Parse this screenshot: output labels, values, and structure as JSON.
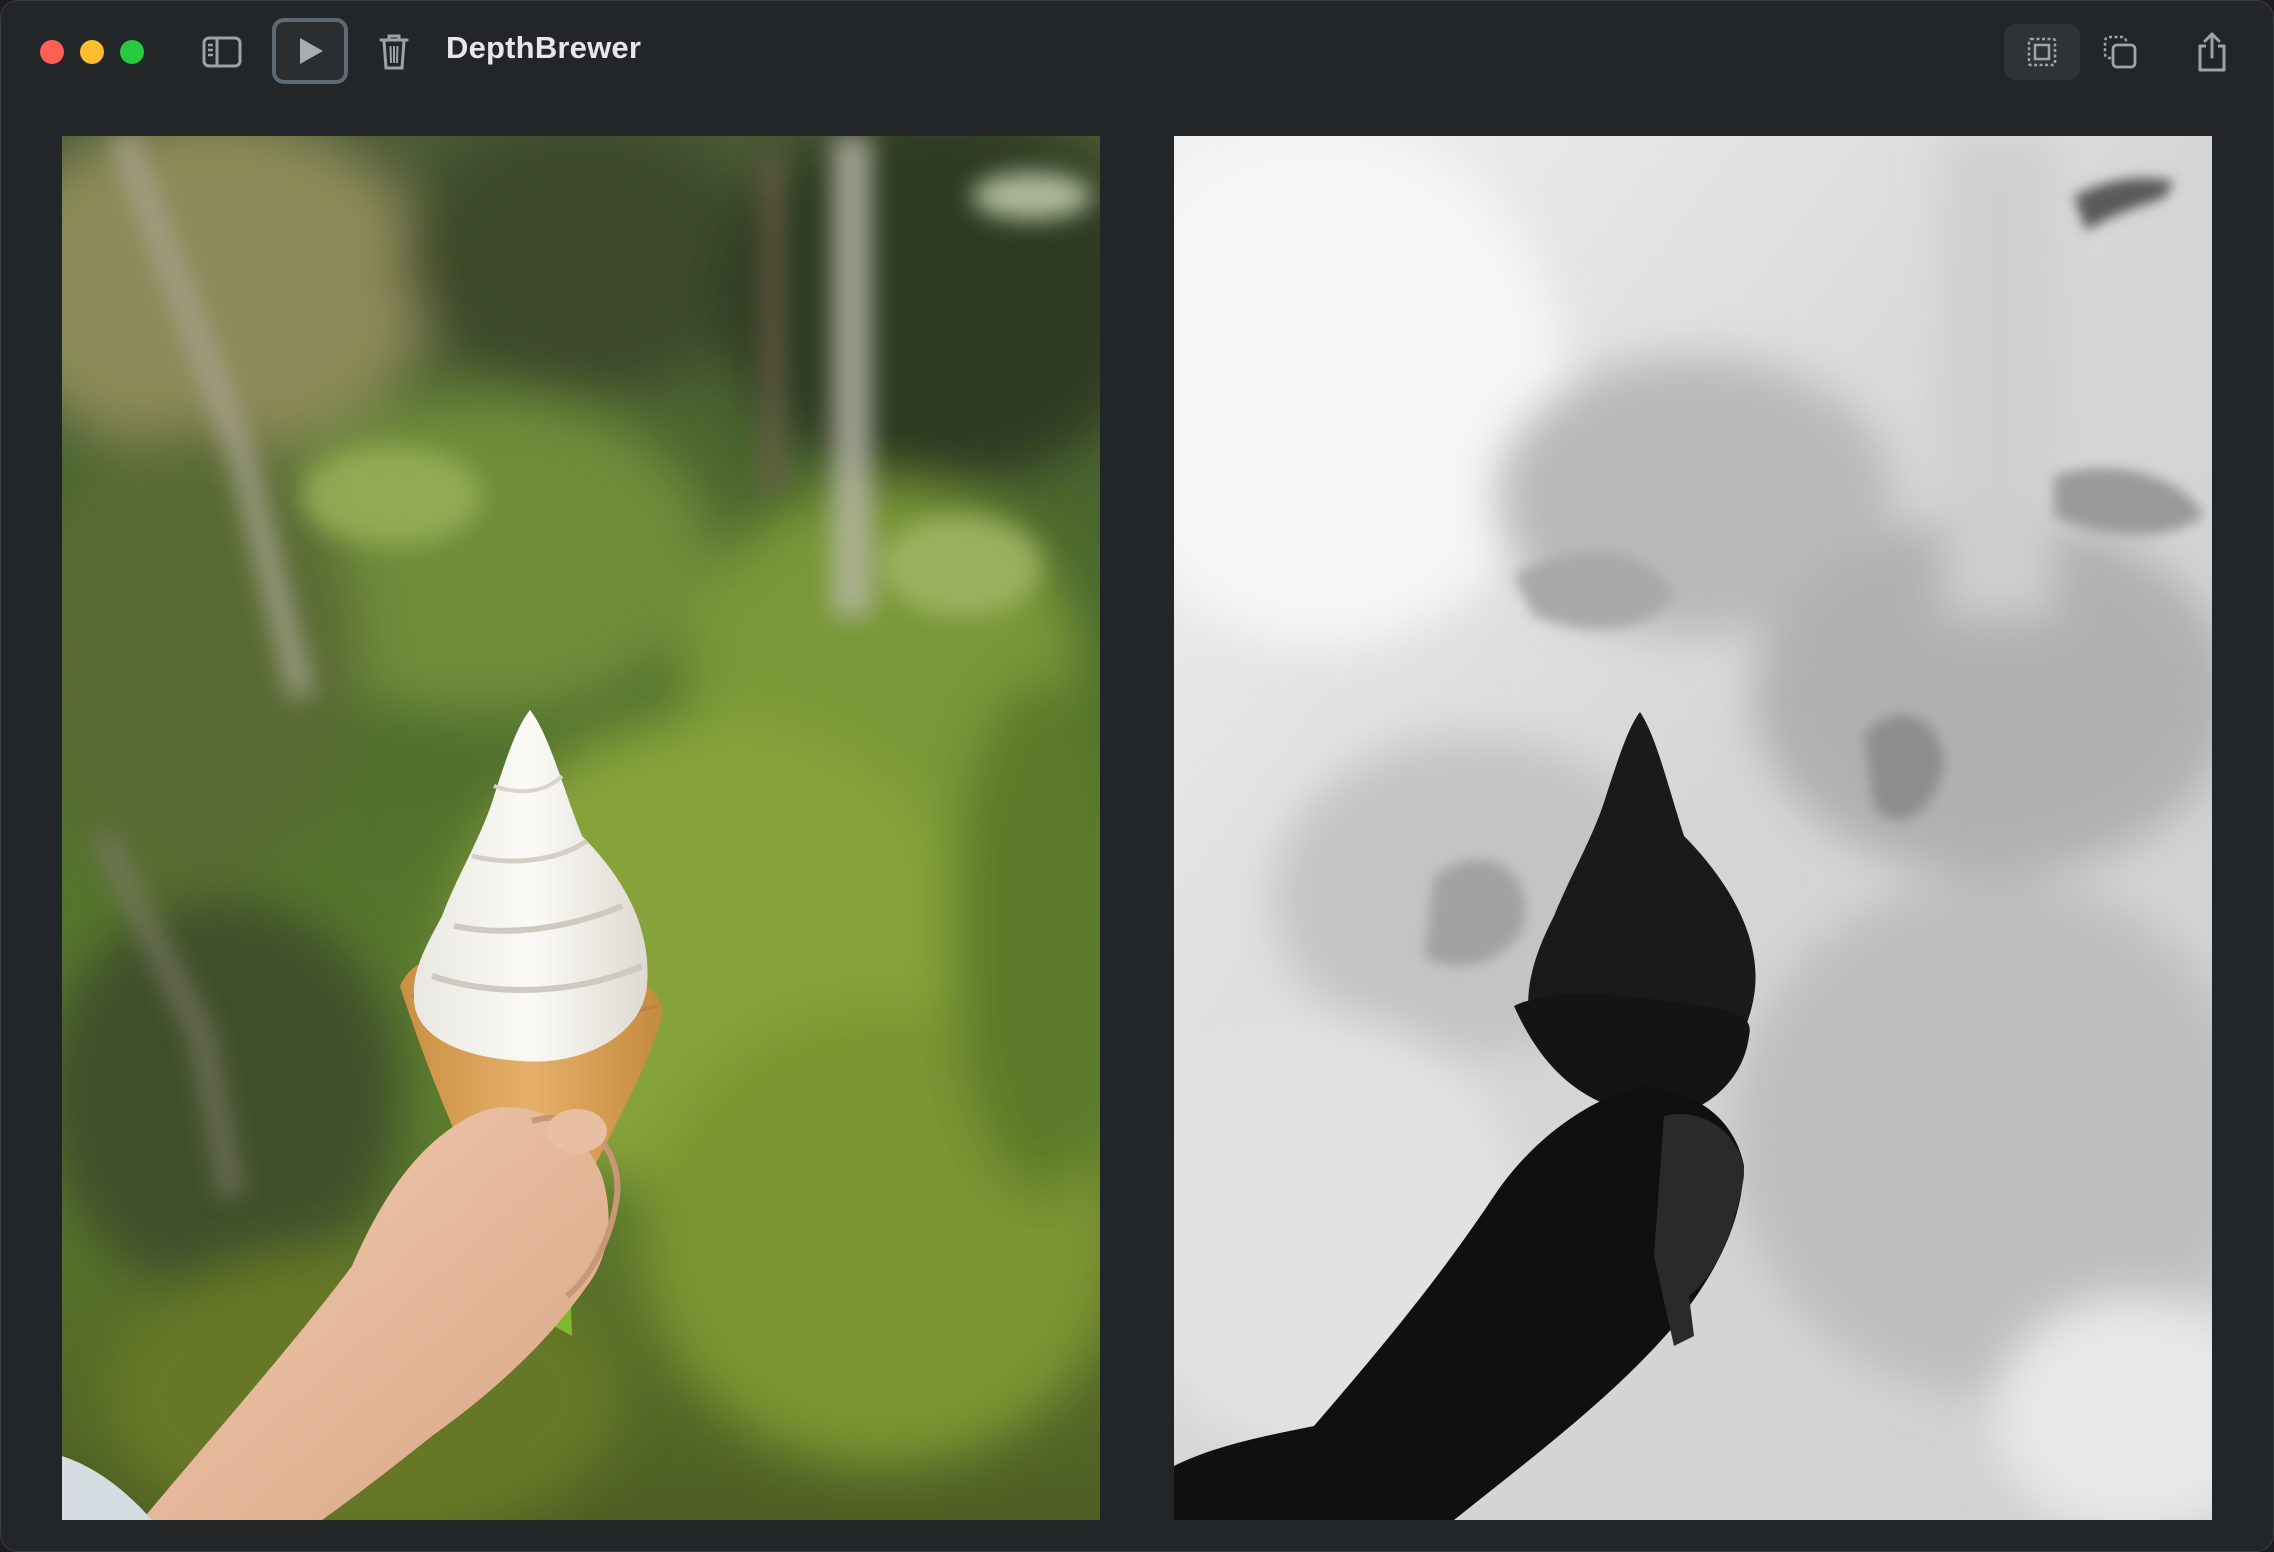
{
  "app": {
    "title": "DepthBrewer"
  },
  "toolbar": {
    "buttons": [
      {
        "name": "sidebar-toggle",
        "icon": "sidebar-icon"
      },
      {
        "name": "play",
        "icon": "play-icon",
        "state": "focused"
      },
      {
        "name": "delete",
        "icon": "trash-icon"
      },
      {
        "name": "frame",
        "icon": "frame-selection-icon",
        "state": "selected"
      },
      {
        "name": "duplicate",
        "icon": "copy-icon"
      },
      {
        "name": "share",
        "icon": "share-icon"
      }
    ]
  },
  "panes": {
    "original": {
      "icon": "photo-soft-serve-ice-cream-cone"
    },
    "depth": {
      "icon": "depth-map-grayscale"
    }
  },
  "colors": {
    "window_bg": "#232628",
    "title_text": "#e6e7e8",
    "icon": "#9ea3a8",
    "close": "#ff5f57",
    "minimize": "#febc2e",
    "maximize": "#28c840"
  }
}
